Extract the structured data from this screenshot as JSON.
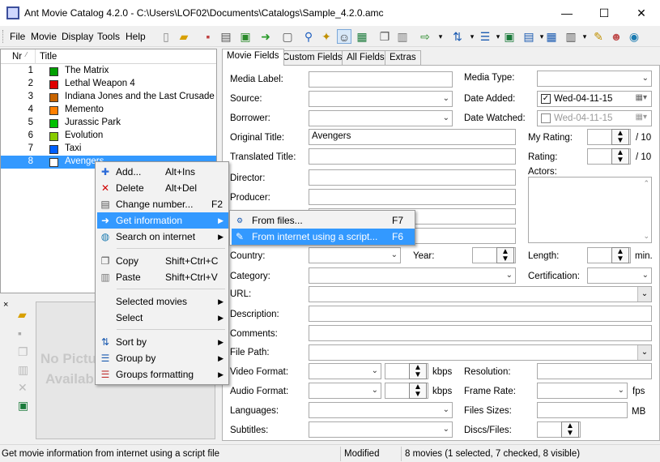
{
  "window": {
    "title": "Ant Movie Catalog 4.2.0 - C:\\Users\\LOF02\\Documents\\Catalogs\\Sample_4.2.0.amc",
    "minimize": "—",
    "maximize": "☐",
    "close": "✕"
  },
  "menubar": [
    "File",
    "Movie",
    "Display",
    "Tools",
    "Help"
  ],
  "list": {
    "col_nr": "Nr",
    "col_title": "Title",
    "rows": [
      {
        "nr": "1",
        "title": "The Matrix",
        "color": "#00a000"
      },
      {
        "nr": "2",
        "title": "Lethal Weapon 4",
        "color": "#e00000"
      },
      {
        "nr": "3",
        "title": "Indiana Jones and the Last Crusade",
        "color": "#c86400"
      },
      {
        "nr": "4",
        "title": "Memento",
        "color": "#ff8000"
      },
      {
        "nr": "5",
        "title": "Jurassic Park",
        "color": "#00c000"
      },
      {
        "nr": "6",
        "title": "Evolution",
        "color": "#88cc00"
      },
      {
        "nr": "7",
        "title": "Taxi",
        "color": "#0060ff"
      },
      {
        "nr": "8",
        "title": "Avengers",
        "color": "#ffffff"
      }
    ]
  },
  "image": {
    "no_picture": "No Picture",
    "available": "Available"
  },
  "tabs": [
    "Movie Fields",
    "Custom Fields",
    "All Fields",
    "Extras"
  ],
  "fields": {
    "media_label": "Media Label:",
    "media_type": "Media Type:",
    "source": "Source:",
    "date_added": "Date Added:",
    "date_added_value": "Wed-04-11-15",
    "borrower": "Borrower:",
    "date_watched": "Date Watched:",
    "date_watched_value": "Wed-04-11-15",
    "original_title": "Original Title:",
    "original_title_value": "Avengers",
    "my_rating": "My Rating:",
    "rating": "Rating:",
    "per_ten": "/ 10",
    "translated_title": "Translated Title:",
    "actors": "Actors:",
    "director": "Director:",
    "producer": "Producer:",
    "country": "Country:",
    "year": "Year:",
    "length": "Length:",
    "min": "min.",
    "category": "Category:",
    "certification": "Certification:",
    "url": "URL:",
    "description": "Description:",
    "comments": "Comments:",
    "file_path": "File Path:",
    "video_format": "Video Format:",
    "audio_format": "Audio Format:",
    "kbps": "kbps",
    "resolution": "Resolution:",
    "frame_rate": "Frame Rate:",
    "fps": "fps",
    "languages": "Languages:",
    "files_sizes": "Files Sizes:",
    "mb": "MB",
    "subtitles": "Subtitles:",
    "discs_files": "Discs/Files:"
  },
  "context_menu": {
    "items": [
      {
        "label": "Add...",
        "shortcut": "Alt+Ins",
        "icon": "add-icon"
      },
      {
        "label": "Delete",
        "shortcut": "Alt+Del",
        "icon": "delete-icon"
      },
      {
        "label": "Change number...",
        "shortcut": "F2",
        "icon": "number-icon"
      },
      {
        "label": "Get information",
        "shortcut": "",
        "icon": "get-info-icon"
      },
      {
        "label": "Search on internet",
        "shortcut": "",
        "icon": "globe-icon"
      },
      {
        "label": "Copy",
        "shortcut": "Shift+Ctrl+C",
        "icon": "copy-icon"
      },
      {
        "label": "Paste",
        "shortcut": "Shift+Ctrl+V",
        "icon": "paste-icon"
      },
      {
        "label": "Selected movies",
        "shortcut": "",
        "icon": ""
      },
      {
        "label": "Select",
        "shortcut": "",
        "icon": ""
      },
      {
        "label": "Sort by",
        "shortcut": "",
        "icon": "sort-icon"
      },
      {
        "label": "Group by",
        "shortcut": "",
        "icon": "group-icon"
      },
      {
        "label": "Groups formatting",
        "shortcut": "",
        "icon": "groups-format-icon"
      }
    ]
  },
  "submenu": {
    "items": [
      {
        "label": "From files...",
        "shortcut": "F7"
      },
      {
        "label": "From internet using a script...",
        "shortcut": "F6"
      }
    ]
  },
  "statusbar": {
    "message": "Get movie information from internet using a script file",
    "state": "Modified",
    "count": "8 movies (1 selected, 7 checked, 8 visible)"
  }
}
